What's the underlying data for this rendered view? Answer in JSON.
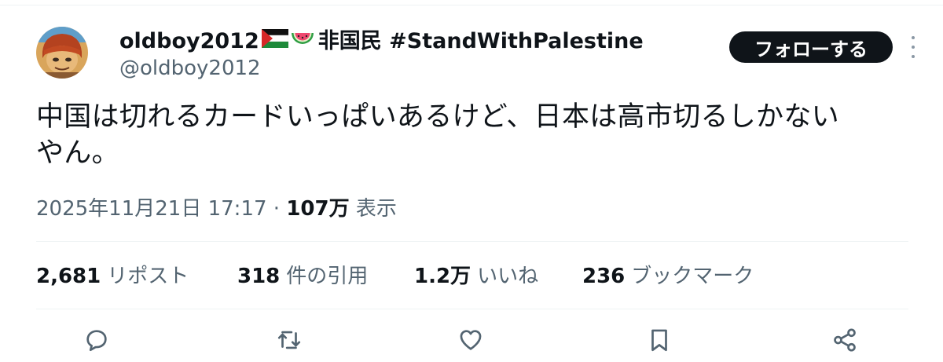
{
  "author": {
    "display_name_prefix": "oldboy2012",
    "display_name_suffix": "非国民 #StandWithPalestine",
    "handle": "@oldboy2012"
  },
  "follow_label": "フォローする",
  "tweet_text_line1": "中国は切れるカードいっぱいあるけど、日本は高市切るしかない",
  "tweet_text_line2": "やん。",
  "meta": {
    "timestamp": "2025年11月21日 17:17",
    "separator": "·",
    "views_count": "107万",
    "views_label": "表示"
  },
  "stats": {
    "reposts_count": "2,681",
    "reposts_label": "リポスト",
    "quotes_count": "318",
    "quotes_label": "件の引用",
    "likes_count": "1.2万",
    "likes_label": "いいね",
    "bookmarks_count": "236",
    "bookmarks_label": "ブックマーク"
  },
  "icons": {
    "reply": "reply-icon",
    "repost": "repost-icon",
    "like": "heart-icon",
    "bookmark": "bookmark-icon",
    "share": "share-icon",
    "more": "more-icon",
    "flag": "palestine-flag-icon",
    "watermelon": "watermelon-icon"
  },
  "colors": {
    "text": "#0f1419",
    "secondary": "#536471",
    "button_bg": "#0f1419",
    "divider": "#eff3f4"
  }
}
